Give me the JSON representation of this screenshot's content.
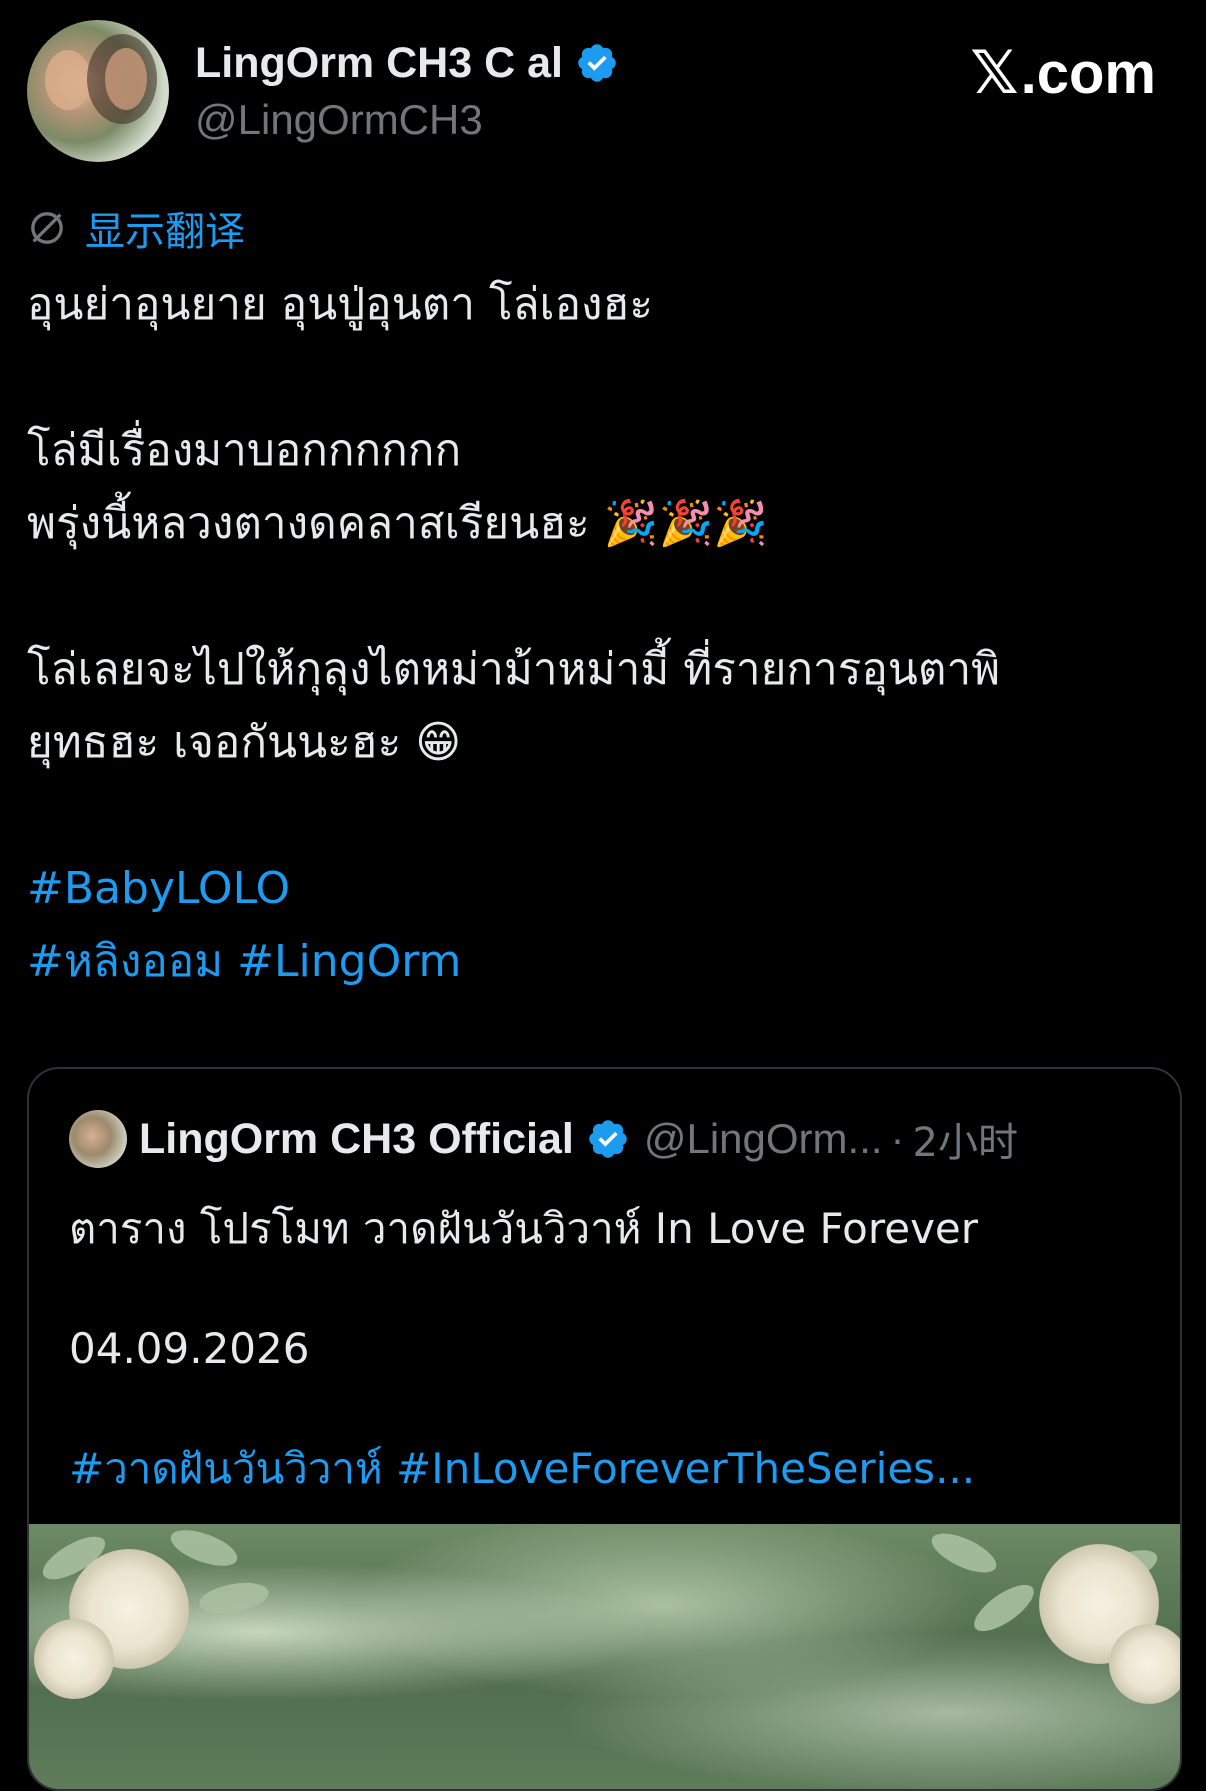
{
  "brand": {
    "label": "X.com",
    "logo": "𝕏",
    "suffix": ".com"
  },
  "author": {
    "display_name": "LingOrm CH3 C   al",
    "handle": "@LingOrmCH3",
    "verified": true
  },
  "translate": {
    "label": "显示翻译",
    "icon": "globe-slash-icon"
  },
  "tweet": {
    "lines": [
      "อุนย่าอุนยาย อุนปู่อุนตา โล่เองฮะ",
      "",
      "โล่มีเรื่องมาบอกกกกกก",
      "พรุ่งนี้หลวงตางดคลาสเรียนฮะ 🎉🎉🎉",
      "",
      "โล่เลยจะไปให้กุลุงไตหม่าม้าหม่ามี้ ที่รายการอุนตาพิ",
      "ยุทธฮะ เจอกันนะฮะ 😁",
      ""
    ],
    "hashtags_line1": "#BabyLOLO",
    "hashtags_line2": "#หลิงออม #LingOrm"
  },
  "quoted": {
    "display_name": "LingOrm CH3 Official",
    "handle": "@LingOrm...",
    "separator": "·",
    "time": "2小时",
    "text_line1": "ตาราง โปรโมท วาดฝันวันวิวาห์ In Love Forever",
    "text_line2": "04.09.2026",
    "hashtags": "#วาดฝันวันวิวาห์ #InLoveForeverTheSeries..."
  },
  "colors": {
    "background": "#000000",
    "text": "#e7e9ea",
    "secondary": "#71767b",
    "link": "#1d9bf0",
    "border": "#2f3336"
  }
}
